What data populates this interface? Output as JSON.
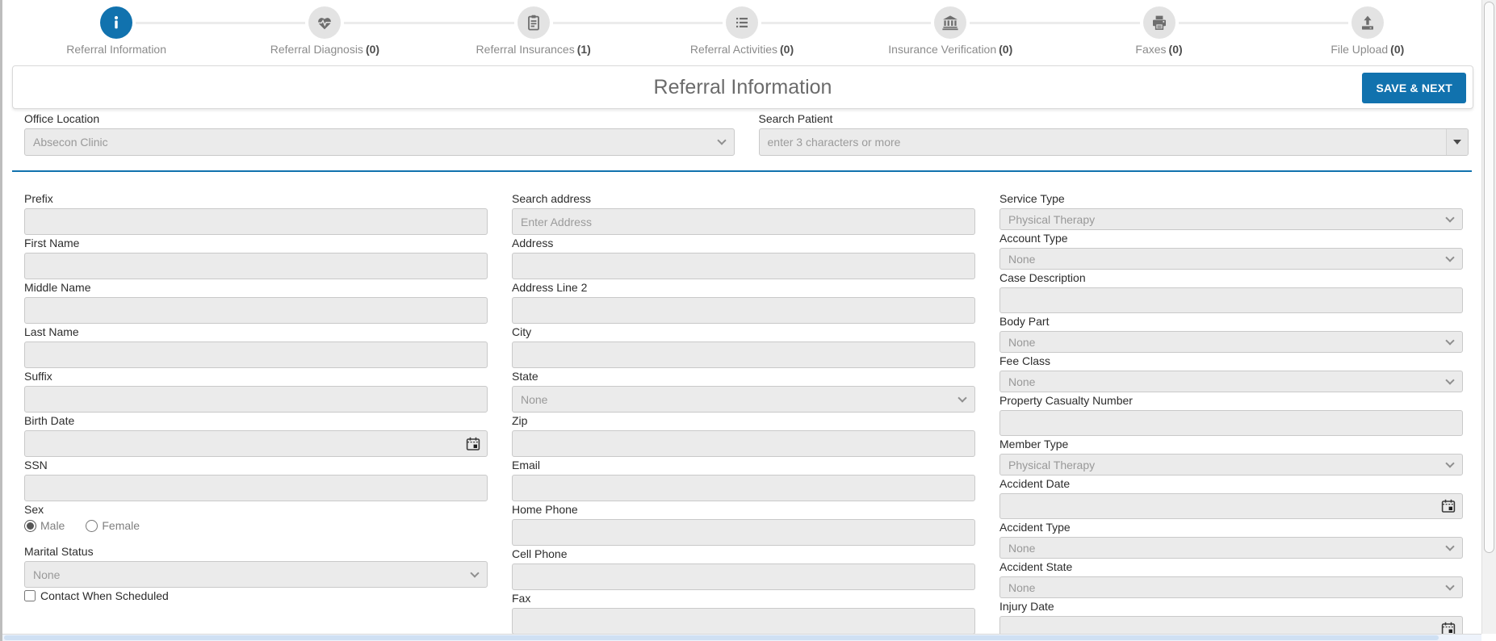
{
  "stepper": {
    "steps": [
      {
        "label": "Referral Information",
        "count": "",
        "icon": "info-icon",
        "active": true
      },
      {
        "label": "Referral Diagnosis",
        "count": "(0)",
        "icon": "diagnosis-icon",
        "active": false
      },
      {
        "label": "Referral Insurances",
        "count": "(1)",
        "icon": "insurances-icon",
        "active": false
      },
      {
        "label": "Referral Activities",
        "count": "(0)",
        "icon": "activities-icon",
        "active": false
      },
      {
        "label": "Insurance Verification",
        "count": "(0)",
        "icon": "bank-icon",
        "active": false
      },
      {
        "label": "Faxes",
        "count": "(0)",
        "icon": "fax-icon",
        "active": false
      },
      {
        "label": "File Upload",
        "count": "(0)",
        "icon": "upload-icon",
        "active": false
      }
    ]
  },
  "header": {
    "title": "Referral Information",
    "save_button": "SAVE & NEXT"
  },
  "top_fields": {
    "office_location": {
      "label": "Office Location",
      "value": "Absecon Clinic"
    },
    "search_patient": {
      "label": "Search Patient",
      "placeholder": "enter 3 characters or more"
    }
  },
  "form": {
    "column1": [
      {
        "label": "Prefix",
        "type": "text",
        "value": ""
      },
      {
        "label": "First Name",
        "type": "text",
        "value": ""
      },
      {
        "label": "Middle Name",
        "type": "text",
        "value": ""
      },
      {
        "label": "Last Name",
        "type": "text",
        "value": ""
      },
      {
        "label": "Suffix",
        "type": "text",
        "value": ""
      },
      {
        "label": "Birth Date",
        "type": "date",
        "value": ""
      },
      {
        "label": "SSN",
        "type": "text",
        "value": ""
      },
      {
        "label": "Sex",
        "type": "radio",
        "options": [
          {
            "label": "Male",
            "selected": true
          },
          {
            "label": "Female",
            "selected": false
          }
        ]
      },
      {
        "label": "Marital Status",
        "type": "select",
        "value": "None"
      },
      {
        "label": "Contact When Scheduled",
        "type": "checkbox",
        "checked": false
      }
    ],
    "column2": [
      {
        "label": "Search address",
        "type": "text",
        "value": "",
        "placeholder": "Enter Address"
      },
      {
        "label": "Address",
        "type": "text",
        "value": ""
      },
      {
        "label": "Address Line 2",
        "type": "text",
        "value": ""
      },
      {
        "label": "City",
        "type": "text",
        "value": ""
      },
      {
        "label": "State",
        "type": "select",
        "value": "None"
      },
      {
        "label": "Zip",
        "type": "text",
        "value": ""
      },
      {
        "label": "Email",
        "type": "text",
        "value": ""
      },
      {
        "label": "Home Phone",
        "type": "text",
        "value": ""
      },
      {
        "label": "Cell Phone",
        "type": "text",
        "value": ""
      },
      {
        "label": "Fax",
        "type": "text",
        "value": ""
      }
    ],
    "column3": [
      {
        "label": "Service Type",
        "type": "select",
        "value": "Physical Therapy"
      },
      {
        "label": "Account Type",
        "type": "select",
        "value": "None"
      },
      {
        "label": "Case Description",
        "type": "text",
        "value": ""
      },
      {
        "label": "Body Part",
        "type": "select",
        "value": "None"
      },
      {
        "label": "Fee Class",
        "type": "select",
        "value": "None"
      },
      {
        "label": "Property Casualty Number",
        "type": "text",
        "value": ""
      },
      {
        "label": "Member Type",
        "type": "select",
        "value": "Physical Therapy"
      },
      {
        "label": "Accident Date",
        "type": "date",
        "value": ""
      },
      {
        "label": "Accident Type",
        "type": "select",
        "value": "None"
      },
      {
        "label": "Accident State",
        "type": "select",
        "value": "None"
      },
      {
        "label": "Injury Date",
        "type": "date",
        "value": ""
      }
    ]
  },
  "colors": {
    "accent_blue": "#1172ae",
    "inactive_step_bg": "#e3e3e3",
    "icon_gray": "#6e6e6e",
    "input_bg": "#ebebeb",
    "input_border": "#c9c9c9",
    "muted_text": "#999999",
    "label_text": "#2c2c2c"
  }
}
